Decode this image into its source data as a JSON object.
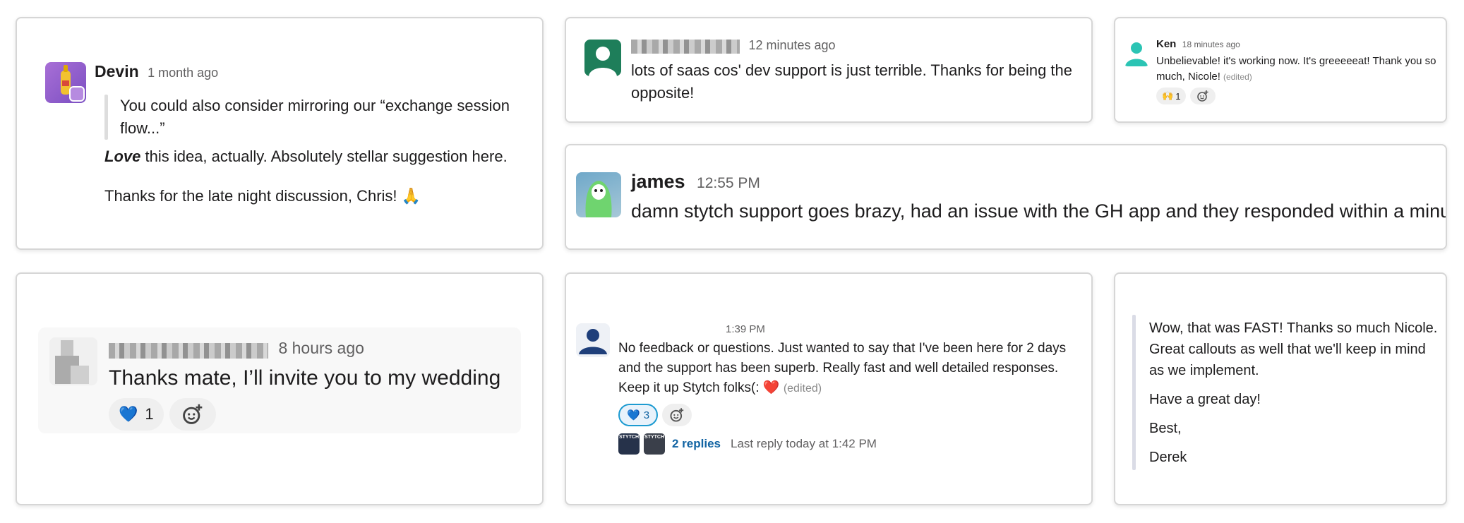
{
  "devin": {
    "name": "Devin",
    "time": "1 month ago",
    "quote": "You could also consider mirroring our “exchange session flow...”",
    "love": "Love",
    "line1_rest": " this idea, actually. Absolutely stellar suggestion here.",
    "line2": "Thanks for the late night discussion, Chris! 🙏"
  },
  "anon_top": {
    "time": "12 minutes ago",
    "text": "lots of saas cos' dev support is just terrible. Thanks for being the opposite!"
  },
  "ken": {
    "name": "Ken",
    "time": "18 minutes ago",
    "text": "Unbelievable! it's working now. It's greeeeeat! Thank you so much, Nicole!",
    "edited": "(edited)",
    "reaction_emoji": "🙌",
    "reaction_count": "1"
  },
  "james": {
    "name": "james",
    "time": "12:55 PM",
    "text": "damn stytch support goes brazy, had an issue with the GH app and they responded within a minute"
  },
  "wedding": {
    "time": "8 hours ago",
    "text": "Thanks mate, I’ll invite you to my wedding",
    "reaction_emoji": "💙",
    "reaction_count": "1"
  },
  "feedback": {
    "time": "1:39 PM",
    "text": "No feedback or questions. Just wanted to say that I've been here for 2 days and the support has been superb. Really fast and well detailed responses. Keep it up Stytch folks(:",
    "heart": "❤️",
    "edited": "(edited)",
    "reaction_emoji": "💙",
    "reaction_count": "3",
    "replies": "2 replies",
    "last_reply": "Last reply today at 1:42 PM",
    "reply_avatar_text": "STYTCH"
  },
  "derek": {
    "p1": "Wow, that was FAST!  Thanks so much Nicole.  Great callouts as well that we'll keep in mind as we implement.",
    "p2": "Have a great day!",
    "p3": "Best,",
    "p4": "Derek"
  },
  "colors": {
    "accent_link": "#1264a3",
    "reaction_active_border": "#1d9bd1",
    "anon_avatar_green": "#1e7e5a",
    "ken_avatar_teal": "#2bc4b4"
  }
}
